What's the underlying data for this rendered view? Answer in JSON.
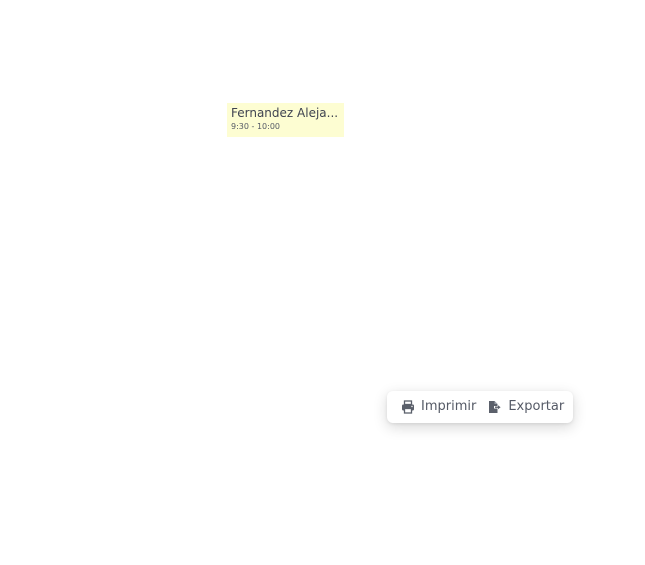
{
  "calendar": {
    "event": {
      "title": "Fernandez Aleja...",
      "time": "9:30 - 10:00",
      "color": "#fdfdd2"
    }
  },
  "toolbar": {
    "print_label": "Imprimir",
    "print_icon": "printer-icon",
    "export_label": "Exportar",
    "export_icon": "file-export-icon"
  }
}
